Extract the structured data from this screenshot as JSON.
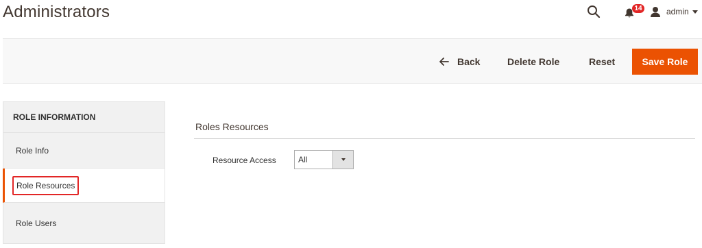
{
  "header": {
    "title": "Administrators",
    "notifications_count": "14",
    "username": "admin"
  },
  "actions": {
    "back_label": "Back",
    "delete_label": "Delete Role",
    "reset_label": "Reset",
    "save_label": "Save Role"
  },
  "sidebar": {
    "heading": "ROLE INFORMATION",
    "items": [
      {
        "label": "Role Info",
        "active": false
      },
      {
        "label": "Role Resources",
        "active": true
      },
      {
        "label": "Role Users",
        "active": false
      }
    ]
  },
  "main": {
    "section_title": "Roles Resources",
    "resource_access_label": "Resource Access",
    "resource_access_value": "All"
  },
  "colors": {
    "accent": "#eb5202",
    "badge": "#e22626",
    "highlight_box": "#e22626"
  },
  "icons": [
    "search-icon",
    "bell-icon",
    "user-icon",
    "chevron-down-icon",
    "arrow-left-icon"
  ]
}
